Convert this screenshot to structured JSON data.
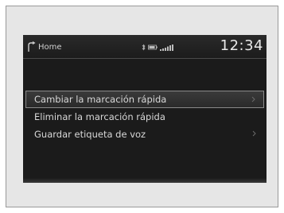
{
  "status_bar": {
    "home_label": "Home",
    "clock": "12:34"
  },
  "icons": {
    "home": "phone-home-icon",
    "bluetooth": "bluetooth-icon",
    "battery": "battery-icon",
    "signal": "signal-strength-icon",
    "chevron": "chevron-right-icon"
  },
  "menu": {
    "items": [
      {
        "label": "Cambiar la marcación rápida",
        "selected": true,
        "has_chevron": true
      },
      {
        "label": "Eliminar la marcación rápida",
        "selected": false,
        "has_chevron": false
      },
      {
        "label": "Guardar etiqueta de voz",
        "selected": false,
        "has_chevron": true
      }
    ]
  },
  "colors": {
    "screen_bg": "#1b1b1b",
    "text": "#d8d8d8",
    "highlight_border": "#8a8a8a"
  }
}
